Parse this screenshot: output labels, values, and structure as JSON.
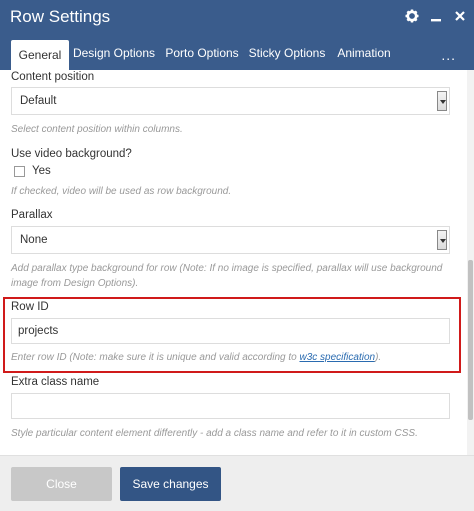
{
  "window": {
    "title": "Row Settings",
    "icons": [
      "gear-icon",
      "minimize-icon",
      "close-icon"
    ]
  },
  "tabs": [
    {
      "label": "General",
      "active": true
    },
    {
      "label": "Design Options",
      "active": false
    },
    {
      "label": "Porto Options",
      "active": false
    },
    {
      "label": "Sticky Options",
      "active": false
    },
    {
      "label": "Animation",
      "active": false
    }
  ],
  "tabs_more": "...",
  "form": {
    "content_position": {
      "label": "Content position",
      "value": "Default",
      "help": "Select content position within columns."
    },
    "video_background": {
      "label": "Use video background?",
      "option": "Yes",
      "checked": false,
      "help": "If checked, video will be used as row background."
    },
    "parallax": {
      "label": "Parallax",
      "value": "None",
      "help_line1": "Add parallax type background for row (Note: If no image is specified, parallax will use background",
      "help_line2": "image from Design Options)."
    },
    "row_id": {
      "label": "Row ID",
      "value": "projects",
      "help_prefix": "Enter row ID (Note: make sure it is unique and valid according to ",
      "help_link": "w3c specification",
      "help_suffix": ")."
    },
    "extra_class": {
      "label": "Extra class name",
      "value": "",
      "help": "Style particular content element differently - add a class name and refer to it in custom CSS."
    }
  },
  "footer": {
    "close_label": "Close",
    "save_label": "Save changes"
  },
  "colors": {
    "header": "#3a5c8c",
    "highlight_border": "#d01a1a",
    "save_button": "#335585",
    "close_button": "#c8c8c8"
  }
}
